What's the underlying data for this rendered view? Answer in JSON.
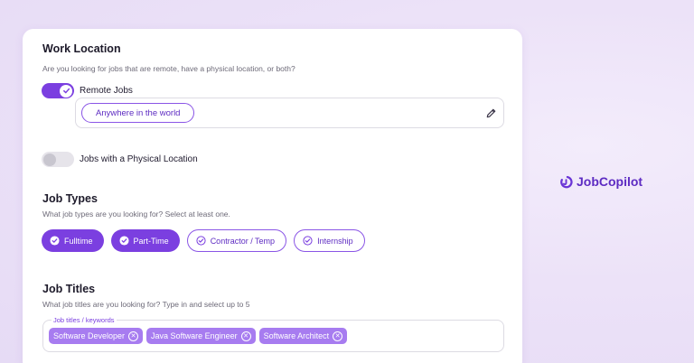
{
  "work_location": {
    "title": "Work Location",
    "description": "Are you looking for jobs that are remote, have a physical location, or both?",
    "remote": {
      "label": "Remote Jobs",
      "enabled": true
    },
    "location_chip": "Anywhere in the world",
    "physical": {
      "label": "Jobs with a Physical Location",
      "enabled": false
    }
  },
  "job_types": {
    "title": "Job Types",
    "description": "What job types are you looking for? Select at least one.",
    "options": [
      {
        "label": "Fulltime",
        "selected": true
      },
      {
        "label": "Part-Time",
        "selected": true
      },
      {
        "label": "Contractor / Temp",
        "selected": false
      },
      {
        "label": "Internship",
        "selected": false
      }
    ]
  },
  "job_titles": {
    "title": "Job Titles",
    "description": "What job titles are you looking for? Type in and select up to 5",
    "field_label": "Job titles / keywords",
    "tags": [
      "Software Developer",
      "Java Software Engineer",
      "Software Architect"
    ]
  },
  "brand": {
    "name": "JobCopilot"
  },
  "colors": {
    "accent": "#7b3fe0",
    "tag": "#a77cf0",
    "background": "#ece2f8"
  }
}
